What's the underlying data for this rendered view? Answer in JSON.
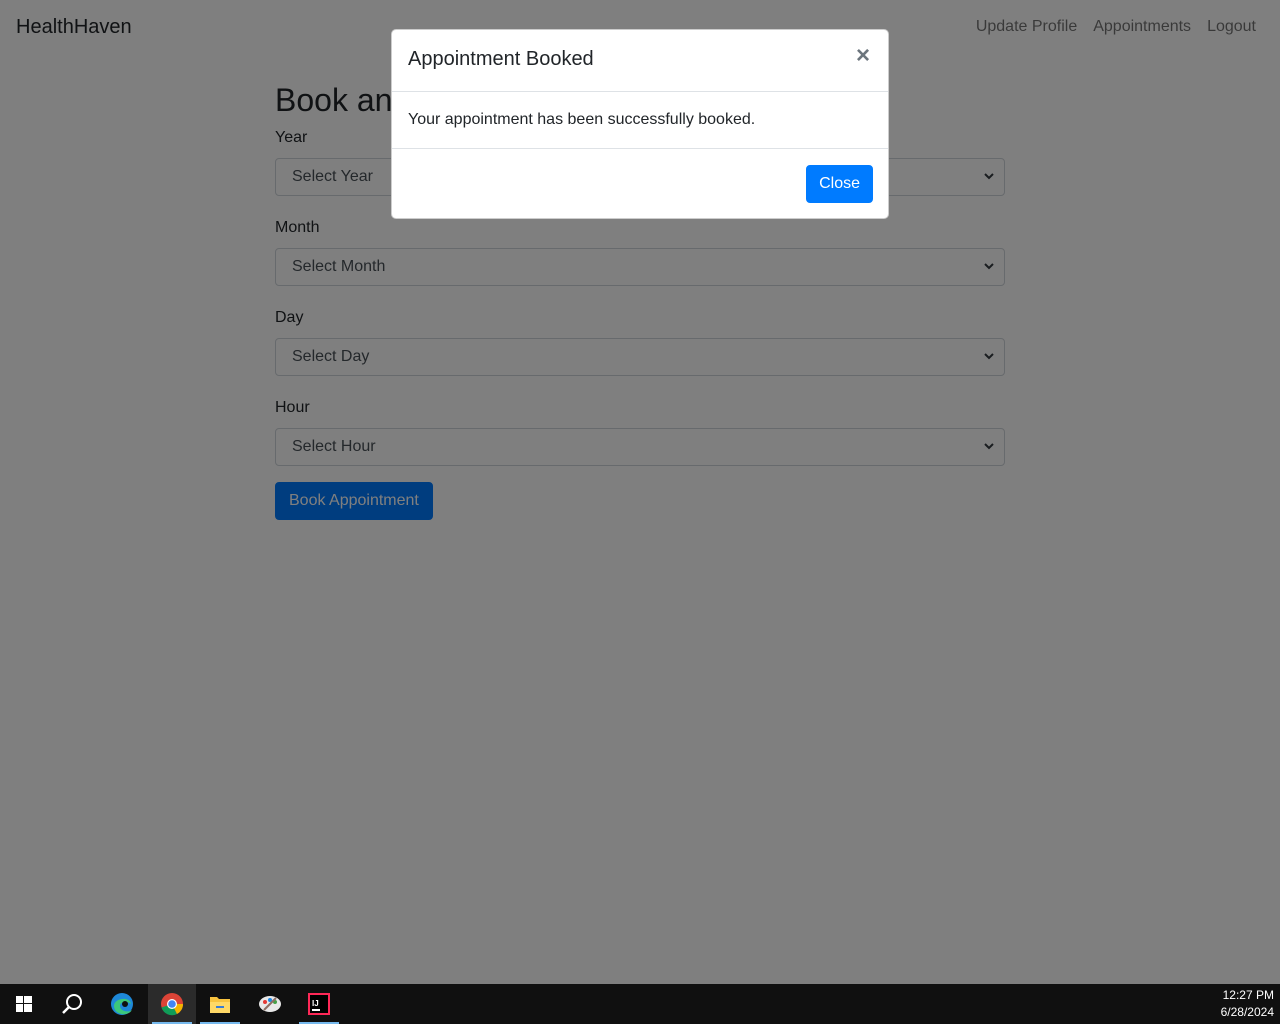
{
  "navbar": {
    "brand": "HealthHaven",
    "links": [
      "Update Profile",
      "Appointments",
      "Logout"
    ]
  },
  "main": {
    "title": "Book an Appointment",
    "fields": [
      {
        "label": "Year",
        "value": "Select Year"
      },
      {
        "label": "Month",
        "value": "Select Month"
      },
      {
        "label": "Day",
        "value": "Select Day"
      },
      {
        "label": "Hour",
        "value": "Select Hour"
      }
    ],
    "submit_label": "Book Appointment"
  },
  "modal": {
    "title": "Appointment Booked",
    "close_symbol": "×",
    "body": "Your appointment has been successfully booked.",
    "close_label": "Close"
  },
  "taskbar": {
    "icons": [
      "windows-start-icon",
      "search-icon",
      "edge-icon",
      "chrome-icon",
      "file-explorer-icon",
      "paint-icon",
      "intellij-icon"
    ],
    "time": "12:27 PM",
    "date": "6/28/2024"
  },
  "colors": {
    "primary": "#007bff",
    "backdrop": "rgba(0,0,0,0.5)",
    "taskbar": "#101010"
  }
}
